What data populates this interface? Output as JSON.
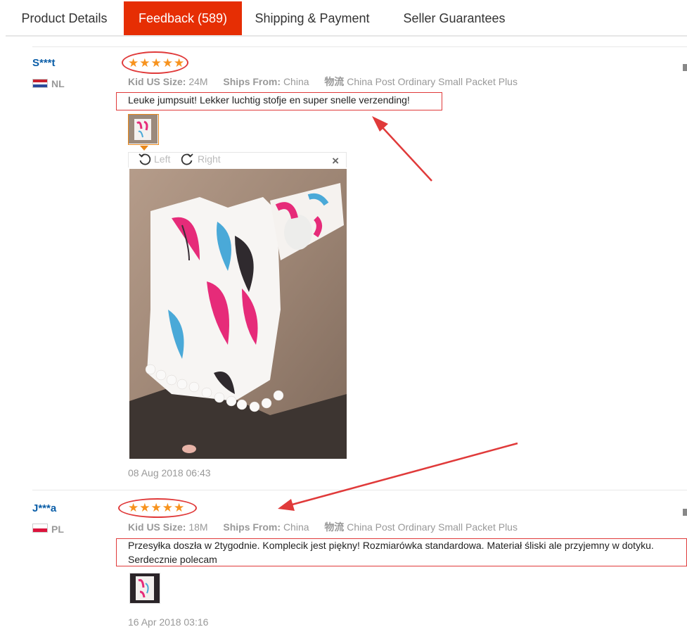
{
  "tabs": [
    {
      "label": "Product Details",
      "active": false
    },
    {
      "label": "Feedback (589)",
      "active": true
    },
    {
      "label": "Shipping & Payment",
      "active": false
    },
    {
      "label": "Seller Guarantees",
      "active": false
    }
  ],
  "colors": {
    "accent": "#e62e04",
    "star": "#f7931e",
    "annotation": "#e03a3a",
    "username": "#0b5ea8"
  },
  "reviews": [
    {
      "user": "S***t",
      "country": "NL",
      "rating": 5,
      "size_label": "Kid US Size:",
      "size_value": "24M",
      "ships_label": "Ships From:",
      "ships_value": "China",
      "logistics_label": "物流",
      "logistics_value": "China Post Ordinary Small Packet Plus",
      "comment": "Leuke jumpsuit! Lekker luchtig stofje en super snelle verzending!",
      "date": "08 Aug 2018 06:43",
      "viewer": {
        "left": "Left",
        "right": "Right",
        "close": "×"
      }
    },
    {
      "user": "J***a",
      "country": "PL",
      "rating": 5,
      "size_label": "Kid US Size:",
      "size_value": "18M",
      "ships_label": "Ships From:",
      "ships_value": "China",
      "logistics_label": "物流",
      "logistics_value": "China Post Ordinary Small Packet Plus",
      "comment": "Przesyłka doszła w 2tygodnie. Komplecik jest piękny! Rozmiarówka standardowa. Materiał śliski ale przyjemny w dotyku. Serdecznie polecam",
      "date": "16 Apr 2018 03:16"
    }
  ]
}
